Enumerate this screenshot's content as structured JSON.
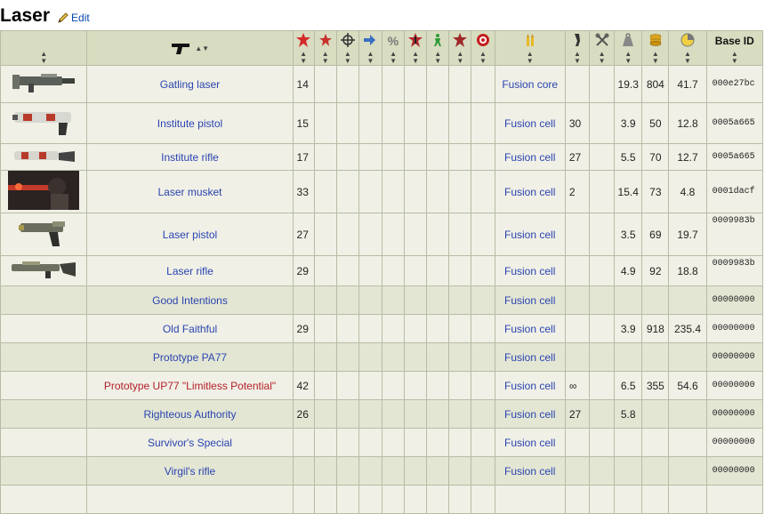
{
  "page": {
    "title": "Laser",
    "edit_label": "Edit"
  },
  "headers": {
    "base_id": "Base ID",
    "icons": [
      "weapon-icon",
      "damage-icon",
      "ap-damage-icon",
      "accuracy-icon",
      "rate-icon",
      "crit-chance-icon",
      "crit-dmg-icon",
      "vats-icon",
      "sneak-icon",
      "limb-icon",
      "ammo-icon",
      "clip-icon",
      "tools-icon",
      "weight-icon",
      "value-icon",
      "dps-icon"
    ]
  },
  "colors": {
    "header_bg": "#d8dcc0",
    "row_bg": "#f0f0e6",
    "row_alt_bg": "#e3e6d3",
    "link": "#2a44b0",
    "link_unique": "#b5202a"
  },
  "rows": [
    {
      "name": "Gatling laser",
      "damage": "14",
      "ammo": "Fusion core",
      "clip": "",
      "weight": "19.3",
      "value": "804",
      "dps": "41.7",
      "base_id": "000e27bc",
      "image": "gatling-laser"
    },
    {
      "name": "Institute pistol",
      "damage": "15",
      "ammo": "Fusion cell",
      "clip": "30",
      "weight": "3.9",
      "value": "50",
      "dps": "12.8",
      "base_id": "0005a665",
      "image": "institute-pistol"
    },
    {
      "name": "Institute rifle",
      "damage": "17",
      "ammo": "Fusion cell",
      "clip": "27",
      "weight": "5.5",
      "value": "70",
      "dps": "12.7",
      "base_id": "0005a665",
      "image": "institute-rifle"
    },
    {
      "name": "Laser musket",
      "damage": "33",
      "ammo": "Fusion cell",
      "clip": "2",
      "weight": "15.4",
      "value": "73",
      "dps": "4.8",
      "base_id": "0001dacf",
      "image": "laser-musket"
    },
    {
      "name": "Laser pistol",
      "damage": "27",
      "ammo": "Fusion cell",
      "clip": "",
      "weight": "3.5",
      "value": "69",
      "dps": "19.7",
      "base_id": "0009983b",
      "image": "laser-pistol"
    },
    {
      "name": "Laser rifle",
      "damage": "29",
      "ammo": "Fusion cell",
      "clip": "",
      "weight": "4.9",
      "value": "92",
      "dps": "18.8",
      "base_id": "0009983b",
      "image": "laser-rifle"
    },
    {
      "name": "Good Intentions",
      "damage": "",
      "ammo": "Fusion cell",
      "clip": "",
      "weight": "",
      "value": "",
      "dps": "",
      "base_id": "00000000"
    },
    {
      "name": "Old Faithful",
      "damage": "29",
      "ammo": "Fusion cell",
      "clip": "",
      "weight": "3.9",
      "value": "918",
      "dps": "235.4",
      "base_id": "00000000"
    },
    {
      "name": "Prototype PA77",
      "damage": "",
      "ammo": "Fusion cell",
      "clip": "",
      "weight": "",
      "value": "",
      "dps": "",
      "base_id": "00000000"
    },
    {
      "name": "Prototype UP77 \"Limitless Potential\"",
      "damage": "42",
      "ammo": "Fusion cell",
      "clip": "∞",
      "weight": "6.5",
      "value": "355",
      "dps": "54.6",
      "base_id": "00000000",
      "unique": true
    },
    {
      "name": "Righteous Authority",
      "damage": "26",
      "ammo": "Fusion cell",
      "clip": "27",
      "weight": "5.8",
      "value": "",
      "dps": "",
      "base_id": "00000000"
    },
    {
      "name": "Survivor's Special",
      "damage": "",
      "ammo": "Fusion cell",
      "clip": "",
      "weight": "",
      "value": "",
      "dps": "",
      "base_id": "00000000"
    },
    {
      "name": "Virgil's rifle",
      "damage": "",
      "ammo": "Fusion cell",
      "clip": "",
      "weight": "",
      "value": "",
      "dps": "",
      "base_id": "00000000"
    },
    {
      "name": "",
      "damage": "",
      "ammo": "",
      "clip": "",
      "weight": "",
      "value": "",
      "dps": "",
      "base_id": ""
    }
  ]
}
